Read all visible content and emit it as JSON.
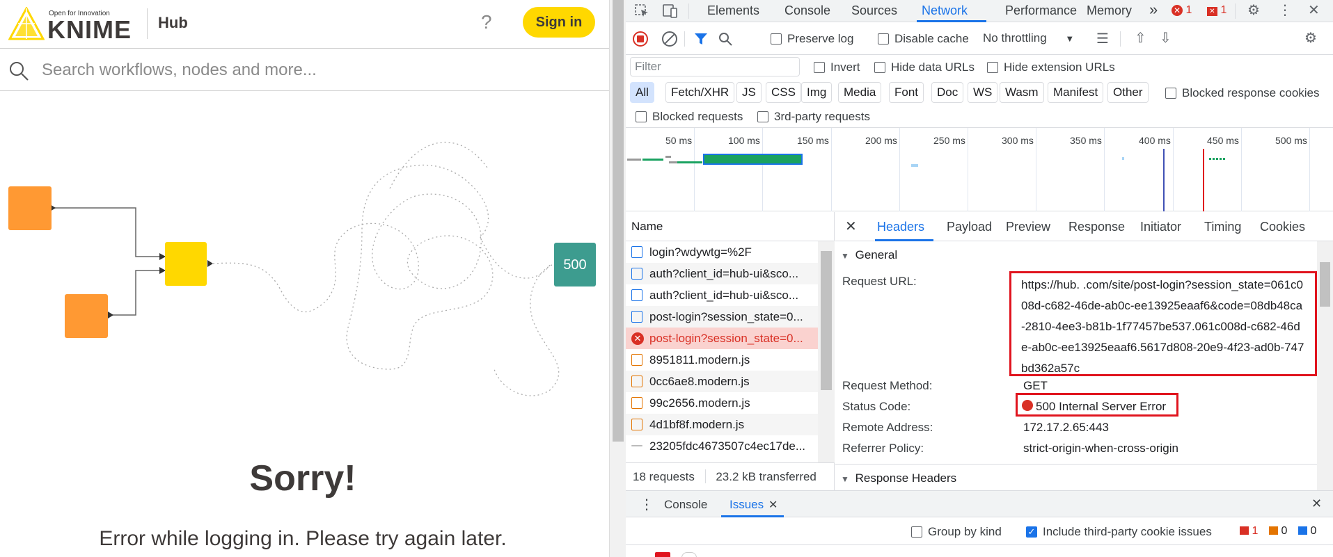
{
  "knime": {
    "tagline": "Open for Innovation",
    "logo_text": "KNIME",
    "hub_label": "Hub",
    "help_glyph": "?",
    "signin_label": "Sign in",
    "search_placeholder": "Search workflows, nodes and more...",
    "error_node_label": "500",
    "sorry_title": "Sorry!",
    "error_message": "Error while logging in. Please try again later.",
    "colors": {
      "brand_yellow": "#ffd800",
      "node_orange": "#ff9933",
      "node_teal": "#3d9c8f"
    }
  },
  "devtools": {
    "tabs": [
      {
        "label": "Elements"
      },
      {
        "label": "Console"
      },
      {
        "label": "Sources"
      },
      {
        "label": "Network"
      },
      {
        "label": "Performance"
      },
      {
        "label": "Memory"
      }
    ],
    "active_tab": "Network",
    "more_tabs_glyph": "»",
    "error_count": "1",
    "issue_count": "1",
    "toolbar": {
      "preserve_log": "Preserve log",
      "disable_cache": "Disable cache",
      "throttling": "No throttling"
    },
    "filter": {
      "placeholder": "Filter",
      "invert": "Invert",
      "hide_data_urls": "Hide data URLs",
      "hide_extension_urls": "Hide extension URLs"
    },
    "type_filters": [
      "All",
      "Fetch/XHR",
      "JS",
      "CSS",
      "Img",
      "Media",
      "Font",
      "Doc",
      "WS",
      "Wasm",
      "Manifest",
      "Other"
    ],
    "blocked_response_cookies": "Blocked response cookies",
    "blocked_requests": "Blocked requests",
    "third_party_requests": "3rd-party requests",
    "timeline_labels": [
      "50 ms",
      "100 ms",
      "150 ms",
      "200 ms",
      "250 ms",
      "300 ms",
      "350 ms",
      "400 ms",
      "450 ms",
      "500 ms"
    ],
    "list": {
      "header": "Name",
      "rows": [
        {
          "name": "login?wdywtg=%2F",
          "kind": "doc"
        },
        {
          "name": "auth?client_id=hub-ui&sco...",
          "kind": "doc"
        },
        {
          "name": "auth?client_id=hub-ui&sco...",
          "kind": "doc"
        },
        {
          "name": "post-login?session_state=0...",
          "kind": "doc"
        },
        {
          "name": "post-login?session_state=0...",
          "kind": "err"
        },
        {
          "name": "8951811.modern.js",
          "kind": "js"
        },
        {
          "name": "0cc6ae8.modern.js",
          "kind": "js"
        },
        {
          "name": "99c2656.modern.js",
          "kind": "js"
        },
        {
          "name": "4d1bf8f.modern.js",
          "kind": "js"
        },
        {
          "name": "23205fdc4673507c4ec17de...",
          "kind": "other"
        }
      ],
      "requests": "18 requests",
      "transferred": "23.2 kB transferred"
    },
    "details": {
      "tabs": [
        "Headers",
        "Payload",
        "Preview",
        "Response",
        "Initiator",
        "Timing",
        "Cookies"
      ],
      "active_tab": "Headers",
      "general_label": "General",
      "request_url_label": "Request URL:",
      "request_url": "https://hub.      .com/site/post-login?session_state=061c008d-c682-46de-ab0c-ee13925eaaf6&code=08db48ca-2810-4ee3-b81b-1f77457be537.061c008d-c682-46de-ab0c-ee13925eaaf6.5617d808-20e9-4f23-ad0b-747bd362a57c",
      "request_method_label": "Request Method:",
      "request_method": "GET",
      "status_code_label": "Status Code:",
      "status_code": "500 Internal Server Error",
      "remote_address_label": "Remote Address:",
      "remote_address": "172.17.2.65:443",
      "referrer_policy_label": "Referrer Policy:",
      "referrer_policy": "strict-origin-when-cross-origin",
      "response_headers_label": "Response Headers"
    },
    "drawer": {
      "tabs": [
        "Console",
        "Issues"
      ],
      "active_tab": "Issues",
      "group_by_kind": "Group by kind",
      "include_third_party": "Include third-party cookie issues",
      "errors": "1",
      "warnings": "0",
      "info": "0"
    },
    "colors": {
      "accent": "#1a73e8",
      "error": "#d93025",
      "highlight_box": "#e0141e"
    }
  }
}
